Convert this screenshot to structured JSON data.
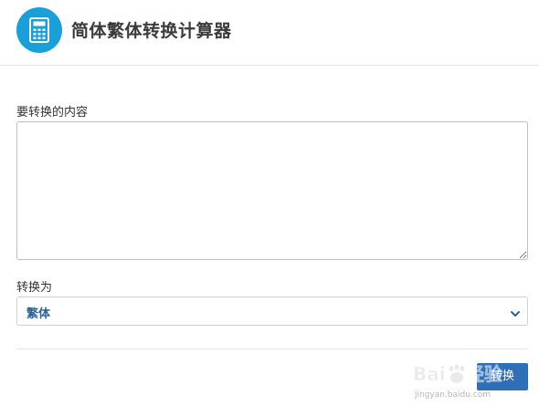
{
  "header": {
    "title": "简体繁体转换计算器",
    "icon": "calculator-icon",
    "icon_bg": "#1aa0d8"
  },
  "form": {
    "content_label": "要转换的内容",
    "content_value": "",
    "target_label": "转换为",
    "target_value": "繁体",
    "target_icon": "chevron-down-icon",
    "target_value_color": "#2a6496"
  },
  "actions": {
    "convert_label": "转换",
    "button_color": "#2e6fb7"
  },
  "watermark": {
    "logo_text": "Baidu经验",
    "url": "jingyan.baidu.com"
  }
}
